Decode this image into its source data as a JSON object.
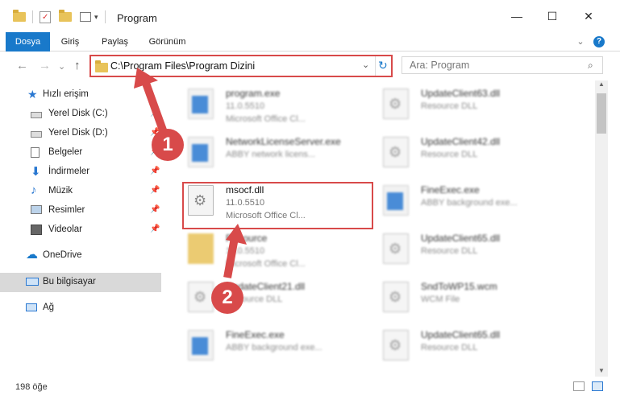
{
  "window": {
    "title": "Program",
    "minimize": "—",
    "maximize": "☐",
    "close": "✕"
  },
  "ribbon": {
    "tabs": [
      "Dosya",
      "Giriş",
      "Paylaş",
      "Görünüm"
    ],
    "expand": "⌄",
    "help": "?"
  },
  "nav": {
    "back": "←",
    "forward": "→",
    "dropdown": "⌄",
    "up": "↑",
    "address": "C:\\Program Files\\Program Dizini",
    "search_placeholder": "Ara: Program"
  },
  "sidebar": {
    "items": [
      {
        "label": "Hızlı erişim"
      },
      {
        "label": "Yerel Disk (C:)"
      },
      {
        "label": "Yerel Disk (D:)"
      },
      {
        "label": "Belgeler"
      },
      {
        "label": "İndirmeler"
      },
      {
        "label": "Müzik"
      },
      {
        "label": "Resimler"
      },
      {
        "label": "Videolar"
      },
      {
        "label": "OneDrive"
      },
      {
        "label": "Bu bilgisayar"
      },
      {
        "label": "Ağ"
      }
    ]
  },
  "files": [
    {
      "name": "program.exe",
      "line1": "11.0.5510",
      "line2": "Microsoft Office Cl...",
      "icon": "exe"
    },
    {
      "name": "UpdateClient63.dll",
      "line1": "Resource DLL",
      "line2": "",
      "icon": "dll"
    },
    {
      "name": "NetworkLicenseServer.exe",
      "line1": "ABBY network licens...",
      "line2": "",
      "icon": "exe"
    },
    {
      "name": "UpdateClient42.dll",
      "line1": "Resource DLL",
      "line2": "",
      "icon": "dll"
    },
    {
      "name": "msocf.dll",
      "line1": "11.0.5510",
      "line2": "Microsoft Office Cl...",
      "icon": "dll"
    },
    {
      "name": "FineExec.exe",
      "line1": "ABBY background exe...",
      "line2": "",
      "icon": "exe"
    },
    {
      "name": "Resource",
      "line1": "11.0.5510",
      "line2": "Microsoft Office Cl...",
      "icon": "folder"
    },
    {
      "name": "UpdateClient65.dll",
      "line1": "Resource DLL",
      "line2": "",
      "icon": "dll"
    },
    {
      "name": "UpdateClient21.dll",
      "line1": "Resource DLL",
      "line2": "",
      "icon": "dll"
    },
    {
      "name": "SndToWP15.wcm",
      "line1": "WCM File",
      "line2": "",
      "icon": "dll"
    },
    {
      "name": "FineExec.exe",
      "line1": "ABBY background exe...",
      "line2": "",
      "icon": "exe"
    },
    {
      "name": "UpdateClient65.dll",
      "line1": "Resource DLL",
      "line2": "",
      "icon": "dll"
    }
  ],
  "annotations": {
    "step1": "1",
    "step2": "2"
  },
  "status": {
    "count": "198 öğe"
  },
  "colors": {
    "accent": "#1979ca",
    "highlight": "#d84a4a"
  }
}
